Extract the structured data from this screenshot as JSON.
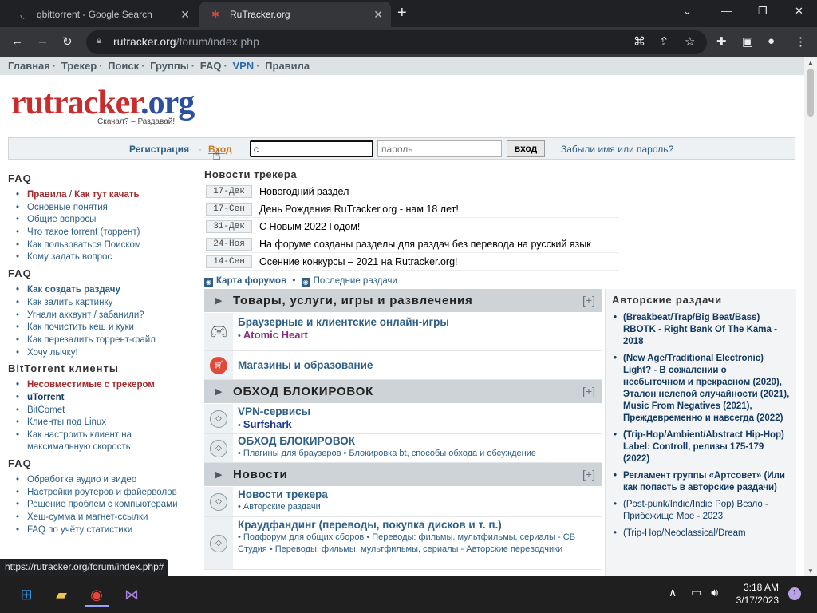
{
  "browser": {
    "tabs": [
      {
        "title": "qbittorrent - Google Search",
        "active": false
      },
      {
        "title": "RuTracker.org",
        "active": true
      }
    ],
    "new_tab": "+",
    "url_host": "rutracker.org",
    "url_path": "/forum/index.php",
    "status_url": "https://rutracker.org/forum/index.php#"
  },
  "site": {
    "nav": [
      "Главная",
      "Трекер",
      "Поиск",
      "Группы",
      "FAQ",
      "VPN",
      "Правила"
    ],
    "logo_main": "rutracker",
    "logo_tld": ".org",
    "logo_tagline": "Скачал? – Раздавай!",
    "login": {
      "register": "Регистрация",
      "sep": "·",
      "enter": "Вход",
      "login_value": "c",
      "password_placeholder": "пароль",
      "button": "вход",
      "forgot": "Забыли имя или пароль?"
    }
  },
  "sidebar": {
    "faq1_title": "FAQ",
    "faq1": [
      "Основные понятия",
      "Общие вопросы",
      "Что такое torrent (торрент)",
      "Как пользоваться Поиском",
      "Кому задать вопрос"
    ],
    "faq1_rules_a": "Правила",
    "faq1_rules_sep": " / ",
    "faq1_rules_b": "Как тут качать",
    "faq2_title": "FAQ",
    "faq2_first": "Как создать раздачу",
    "faq2": [
      "Как залить картинку",
      "Угнали аккаунт / забанили?",
      "Как почистить кеш и куки",
      "Как перезалить торрент-файл",
      "Хочу лычку!"
    ],
    "bt_title": "BitTorrent клиенты",
    "bt_incompat": "Несовместимые с трекером",
    "bt_utorrent": "uTorrent",
    "bt": [
      "BitComet",
      "Клиенты под Linux"
    ],
    "bt_last_1": "Как настроить клиент на",
    "bt_last_2": "максимальную скорость",
    "faq3_title": "FAQ",
    "faq3": [
      "Обработка аудио и видео",
      "Настройки роутеров и файерволов",
      "Решение проблем с компьютерами",
      "Хеш-сумма и магнет-ссылки",
      "FAQ по учёту статистики"
    ]
  },
  "news": {
    "title": "Новости трекера",
    "items": [
      {
        "date": "17-Дек",
        "text": "Новогодний раздел"
      },
      {
        "date": "17-Сен",
        "text": "День Рождения RuTracker.org - нам 18 лет!"
      },
      {
        "date": "31-Дек",
        "text": "С Новым 2022 Годом!"
      },
      {
        "date": "24-Ноя",
        "text": "На форуме созданы разделы для раздач без перевода на русский язык"
      },
      {
        "date": "14-Сен",
        "text": "Осенние конкурсы – 2021 на Rutracker.org!"
      }
    ],
    "map_link": "Карта форумов",
    "links_sep": "•",
    "latest_link": "Последние раздачи"
  },
  "forum": {
    "cat1": "Товары, услуги, игры и развлечения",
    "expand": "[+]",
    "f_games": "Браузерные и клиентские онлайн-игры",
    "f_games_sub": "Atomic Heart",
    "f_shops": "Магазины и образование",
    "cat2": "ОБХОД БЛОКИРОВОК",
    "f_vpn": "VPN-сервисы",
    "f_vpn_sub": "Surfshark",
    "f_bypass": "ОБХОД БЛОКИРОВОК",
    "f_bypass_sub": "• Плагины для браузеров • Блокировка bt, способы обхода и обсуждение",
    "cat3": "Новости",
    "f_news": "Новости трекера",
    "f_news_sub": "• Авторские раздачи",
    "f_crowd": "Краудфандинг (переводы, покупка дисков и т. п.)",
    "f_crowd_sub": "• Подфорум для общих сборов • Переводы: фильмы, мультфильмы, сериалы - СВ Студия • Переводы: фильмы, мультфильмы, сериалы - Авторские переводчики"
  },
  "authors": {
    "title": "Авторские раздачи",
    "items": [
      {
        "text": "(Breakbeat/Trap/Big Beat/Bass) RBOTK - Right Bank Of The Kama - 2018",
        "bold": true
      },
      {
        "text": "(New Age/Traditional Electronic) Light? - В сожалении о несбыточном и прекрасном (2020), Эталон нелепой случайности (2021), Music From Negatives (2021), Преждевременно и навсегда (2022)",
        "bold": true
      },
      {
        "text": "(Trip-Hop/Ambient/Abstract Hip-Hop) Label: Controll, релизы 175-179 (2022)",
        "bold": true
      },
      {
        "text": "Регламент группы «Артсовет» (Или как попасть в авторские раздачи)",
        "bold": true
      },
      {
        "text": "(Post-punk/Indie/Indie Pop) Везло - Прибежище Мое - 2023",
        "bold": false
      },
      {
        "text": "(Trip-Hop/Neoclassical/Dream",
        "bold": false
      }
    ]
  },
  "taskbar": {
    "time": "3:18 AM",
    "date": "3/17/2023",
    "notifications": "1"
  }
}
